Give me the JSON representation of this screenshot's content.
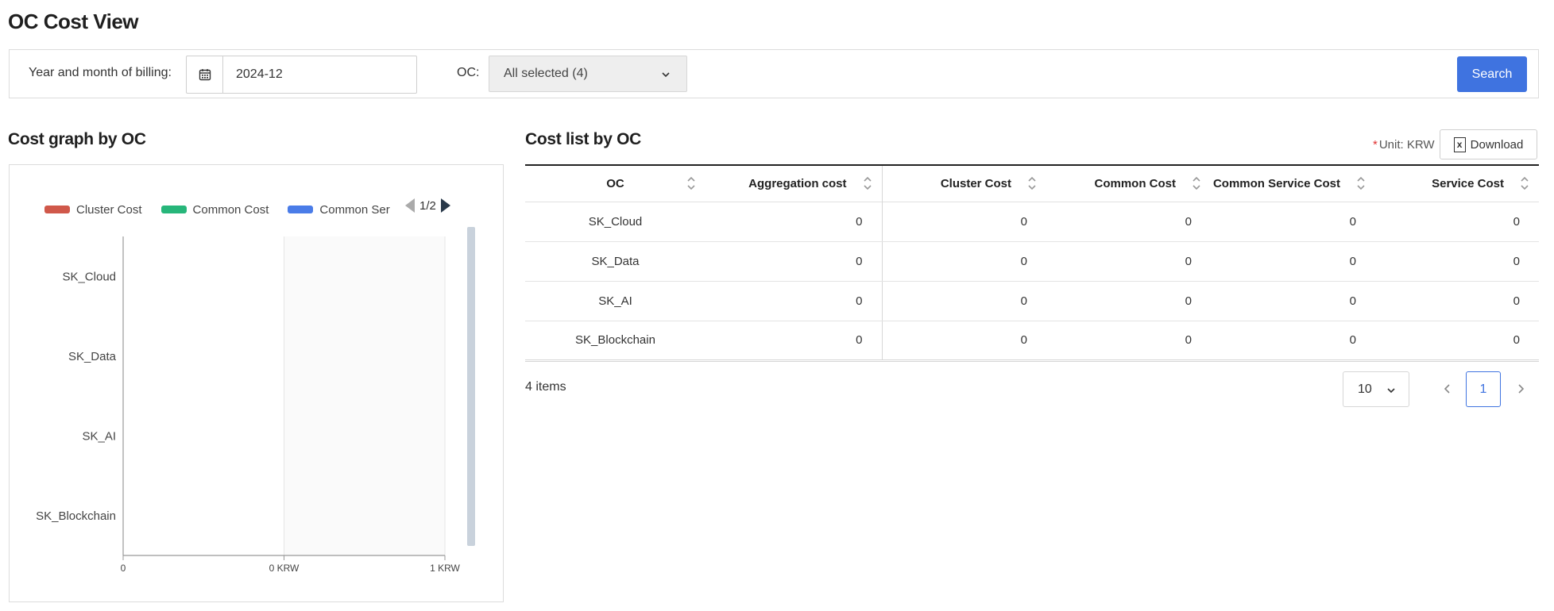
{
  "page": {
    "title": "OC Cost View"
  },
  "filters": {
    "billing_label": "Year and month of billing:",
    "billing_value": "2024-12",
    "oc_label": "OC:",
    "oc_value": "All selected (4)",
    "search_label": "Search"
  },
  "graph": {
    "title": "Cost graph by OC",
    "legend": [
      {
        "label": "Cluster Cost",
        "color": "#d0584a"
      },
      {
        "label": "Common Cost",
        "color": "#27b67a"
      },
      {
        "label": "Common Ser",
        "color": "#4a7ce8"
      }
    ],
    "legend_page": "1/2"
  },
  "chart_data": {
    "type": "bar",
    "orientation": "horizontal",
    "categories": [
      "SK_Cloud",
      "SK_Data",
      "SK_AI",
      "SK_Blockchain"
    ],
    "series": [
      {
        "name": "Cluster Cost",
        "values": [
          0,
          0,
          0,
          0
        ]
      },
      {
        "name": "Common Cost",
        "values": [
          0,
          0,
          0,
          0
        ]
      },
      {
        "name": "Common Ser",
        "values": [
          0,
          0,
          0,
          0
        ]
      }
    ],
    "xticks": [
      "0",
      "0 KRW",
      "1 KRW"
    ],
    "xlim": [
      0,
      1
    ],
    "grid": true,
    "legend_position": "top"
  },
  "list": {
    "title": "Cost list by OC",
    "unit_label": "Unit: KRW",
    "download_label": "Download",
    "columns": [
      "OC",
      "Aggregation cost",
      "Cluster Cost",
      "Common Cost",
      "Common Service Cost",
      "Service Cost"
    ],
    "rows": [
      [
        "SK_Cloud",
        "0",
        "0",
        "0",
        "0",
        "0"
      ],
      [
        "SK_Data",
        "0",
        "0",
        "0",
        "0",
        "0"
      ],
      [
        "SK_AI",
        "0",
        "0",
        "0",
        "0",
        "0"
      ],
      [
        "SK_Blockchain",
        "0",
        "0",
        "0",
        "0",
        "0"
      ]
    ],
    "items_count": "4 items",
    "page_size": "10",
    "current_page": "1"
  },
  "icons": {
    "calendar": "calendar-icon",
    "dropdown": "chevron-down-icon",
    "sort": "sort-icon",
    "excel": "excel-file-icon",
    "prev": "chevron-left-icon",
    "next": "chevron-right-icon"
  }
}
